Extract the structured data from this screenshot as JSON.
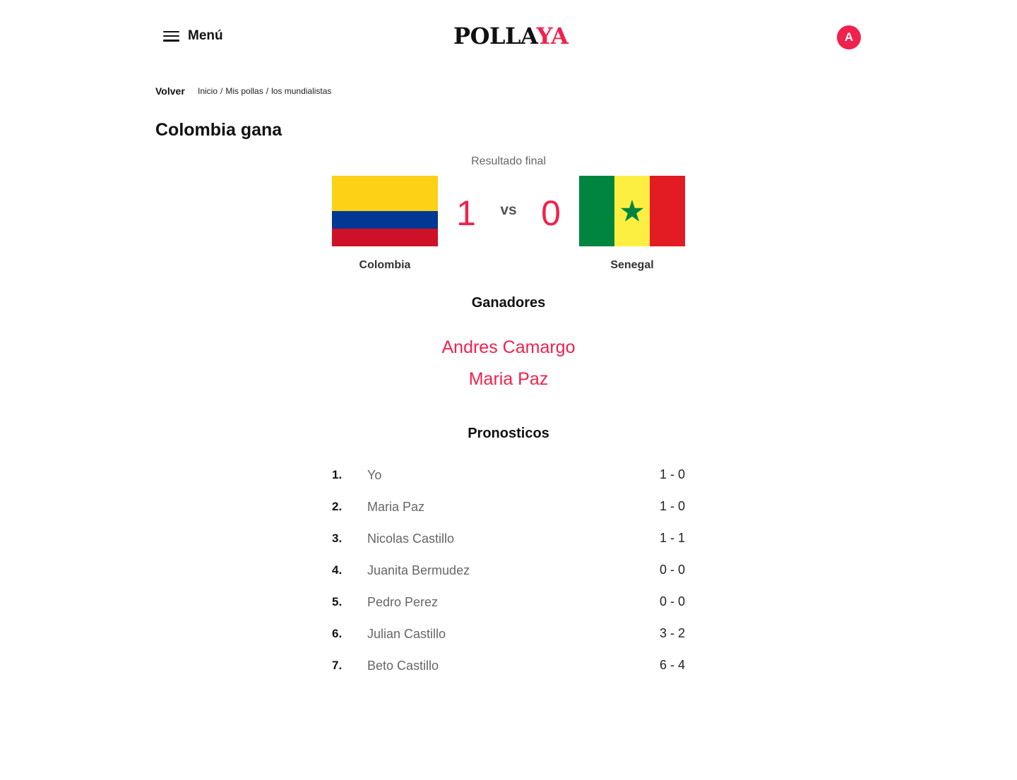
{
  "header": {
    "menu_label": "Menú",
    "logo_part1": "POLLA",
    "logo_part2": "YA",
    "avatar_initial": "A",
    "accent_color": "#f0224d"
  },
  "nav": {
    "back_label": "Volver",
    "breadcrumb": [
      "Inicio",
      "Mis pollas",
      "los mundialistas"
    ],
    "separator": "/"
  },
  "page": {
    "title": "Colombia gana"
  },
  "match": {
    "status": "Resultado final",
    "home_team": "Colombia",
    "away_team": "Senegal",
    "home_score": "1",
    "away_score": "0",
    "vs_label": "vs",
    "home_flag_icon": "colombia-flag-icon",
    "away_flag_icon": "senegal-flag-icon"
  },
  "winners": {
    "heading": "Ganadores",
    "names": [
      "Andres Camargo",
      "Maria Paz"
    ]
  },
  "predictions": {
    "heading": "Pronosticos",
    "rows": [
      {
        "rank": "1.",
        "name": "Yo",
        "score": "1 - 0"
      },
      {
        "rank": "2.",
        "name": "Maria Paz",
        "score": "1 - 0"
      },
      {
        "rank": "3.",
        "name": "Nicolas Castillo",
        "score": "1 - 1"
      },
      {
        "rank": "4.",
        "name": "Juanita Bermudez",
        "score": "0 - 0"
      },
      {
        "rank": "5.",
        "name": "Pedro Perez",
        "score": "0 - 0"
      },
      {
        "rank": "6.",
        "name": "Julian Castillo",
        "score": "3 - 2"
      },
      {
        "rank": "7.",
        "name": "Beto Castillo",
        "score": "6 - 4"
      }
    ]
  }
}
